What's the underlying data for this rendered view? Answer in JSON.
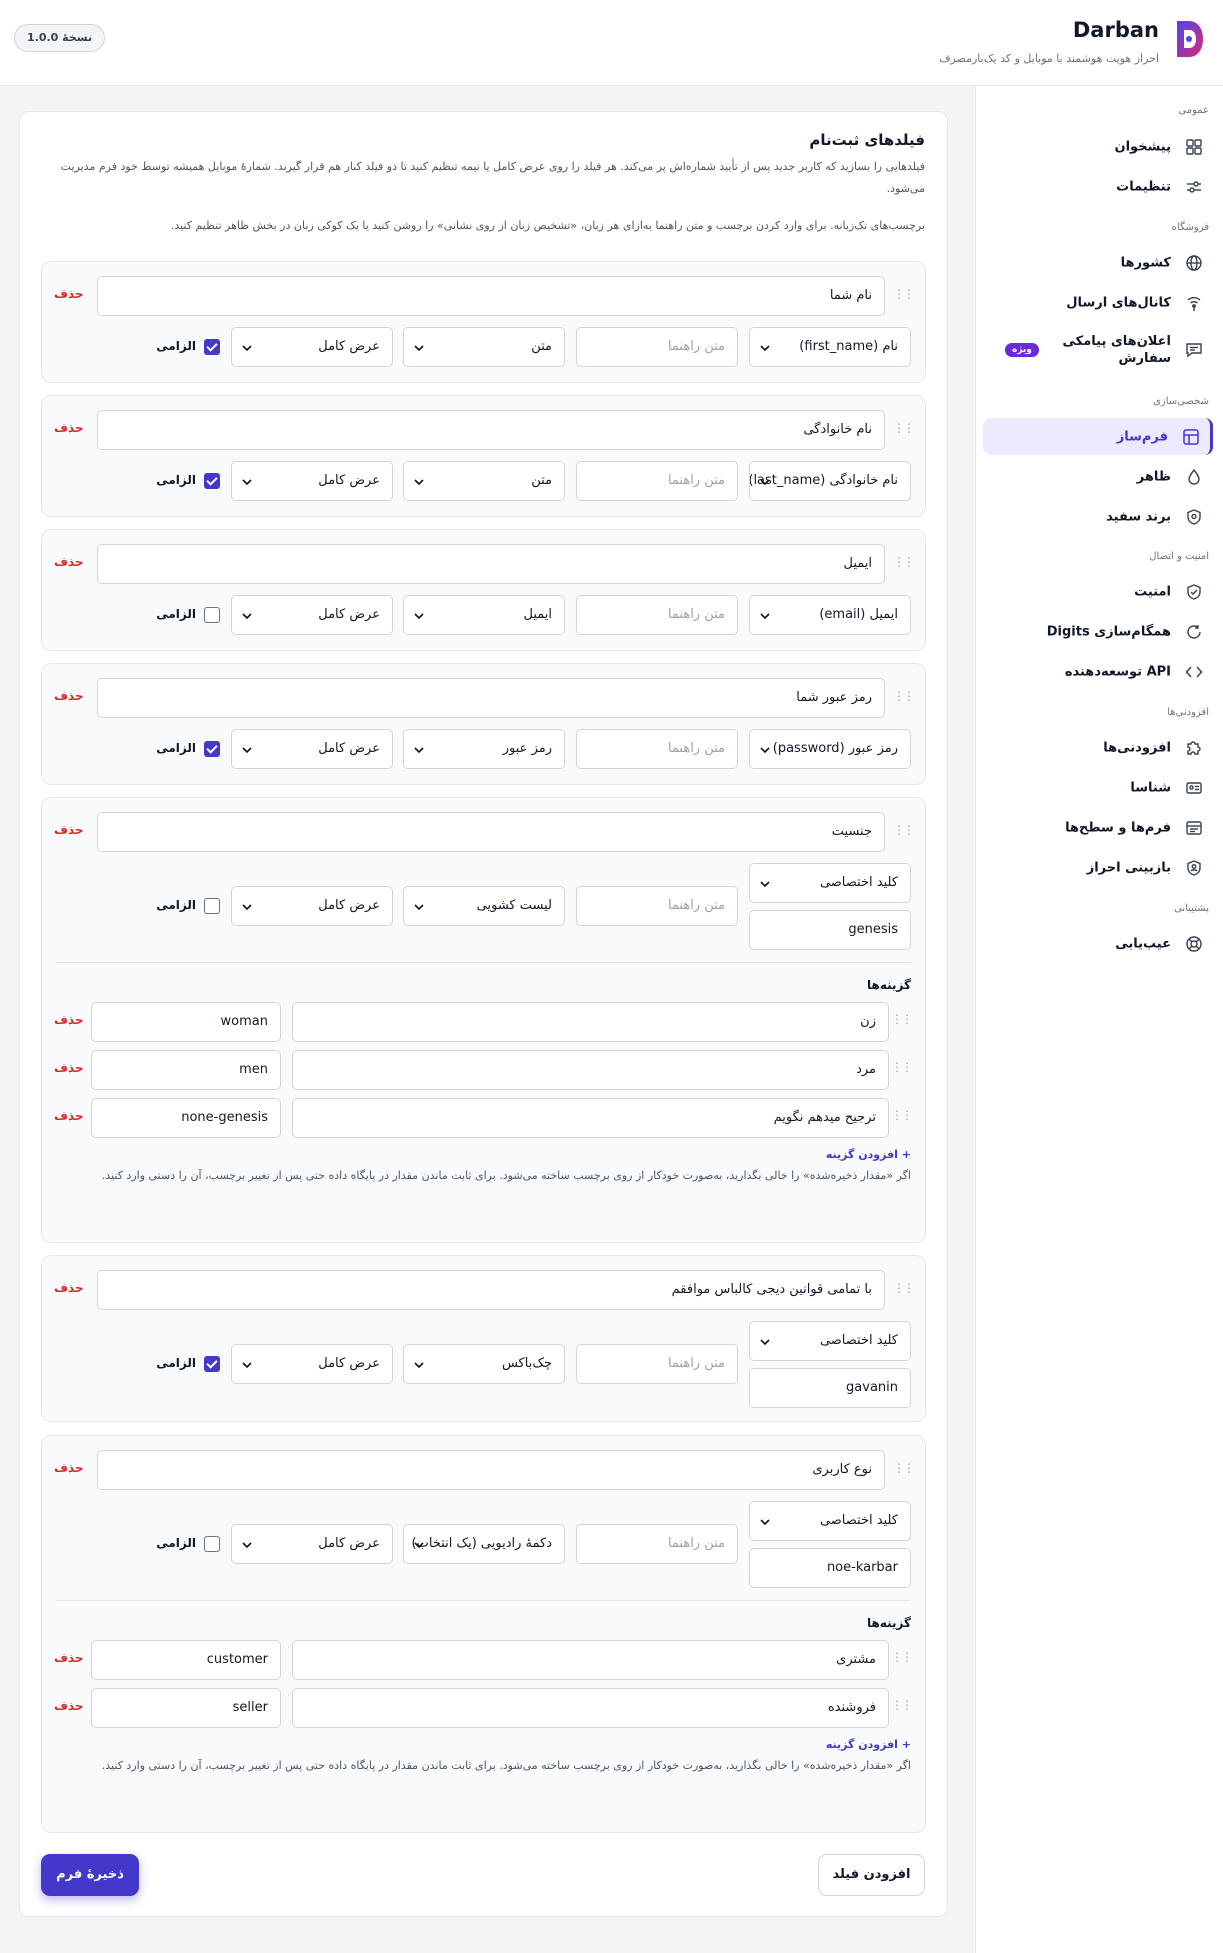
{
  "app": {
    "brand": "Darban",
    "tagline": "احراز هویت هوشمند با موبایل و کد یک‌بارمصرف",
    "version": "نسخهٔ 1.0.0"
  },
  "sidebar": {
    "sections": {
      "general": "عمومی",
      "shop": "فروشگاه",
      "custom": "شخصی‌سازی",
      "security": "امنیت و اتصال",
      "addons": "افزودنی‌ها",
      "support": "پشتیبانی"
    },
    "items": {
      "dashboard": "پیشخوان",
      "settings": "تنظیمات",
      "countries": "کشورها",
      "channels": "کانال‌های ارسال",
      "sms": "اعلان‌های پیامکی سفارش",
      "formbuilder": "فرم‌ساز",
      "appearance": "ظاهر",
      "whitelabel": "برند سفید",
      "security": "امنیت",
      "digits": "همگام‌سازی Digits",
      "api": "API توسعه‌دهنده",
      "addons": "افزودنی‌ها",
      "shenasa": "شناسا",
      "forms": "فرم‌ها و سطح‌ها",
      "reverify": "بازبینی احراز",
      "troubleshoot": "عیب‌یابی"
    },
    "badge": "ویژه"
  },
  "card": {
    "title": "فیلدهای ثبت‌نام",
    "desc": "فیلدهایی را بسازید که کاربر جدید پس از تأیید شماره‌اش پر می‌کند. هر فیلد را روی عرض کامل یا نیمه تنظیم کنید تا دو فیلد کنار هم قرار گیرند. شمارهٔ موبایل همیشه توسط خود فرم مدیریت می‌شود.",
    "note": "برچسب‌های تک‌زبانه. برای وارد کردن برچسب و متن راهنما به‌ازای هر زبان، «تشخیص زبان از روی نشانی» را روشن کنید یا یک کوکی زبان در بخش ظاهر تنظیم کنید."
  },
  "common": {
    "delete": "حذف",
    "required": "الزامی",
    "hint_placeholder": "متن راهنما",
    "width_full": "عرض کامل",
    "custom_key": "کلید اختصاصی",
    "options_title": "گزینه‌ها",
    "add_option": "+ افزودن گزینه",
    "option_hint": "اگر «مقدار ذخیره‌شده» را خالی بگذارید، به‌صورت خودکار از روی برچسب ساخته می‌شود. برای ثابت ماندن مقدار در پایگاه داده حتی پس از تغییر برچسب، آن را دستی وارد کنید."
  },
  "fields": [
    {
      "label": "نام شما",
      "key": "نام (first_name)",
      "type": "متن",
      "required": true
    },
    {
      "label": "نام خانوادگی",
      "key": "نام خانوادگی (last_name)",
      "type": "متن",
      "required": true
    },
    {
      "label": "ایمیل",
      "key": "ایمیل (email)",
      "type": "ایمیل",
      "required": false
    },
    {
      "label": "رمز عبور شما",
      "key": "رمز عبور (password)",
      "type": "رمز عبور",
      "required": true
    },
    {
      "label": "جنسیت",
      "custom_value": "genesis",
      "type": "لیست کشویی",
      "required": false,
      "options": [
        {
          "label": "زن",
          "value": "woman"
        },
        {
          "label": "مرد",
          "value": "men"
        },
        {
          "label": "ترجیح میدهم نگویم",
          "value": "none-genesis"
        }
      ]
    },
    {
      "label": "با تمامی قوانین دیجی کالباس موافقم",
      "custom_value": "gavanin",
      "type": "چک‌باکس",
      "required": true
    },
    {
      "label": "نوع کاربری",
      "custom_value": "noe-karbar",
      "type": "دکمهٔ رادیویی (یک انتخاب)",
      "required": false,
      "options": [
        {
          "label": "مشتری",
          "value": "customer"
        },
        {
          "label": "فروشنده",
          "value": "seller"
        }
      ]
    }
  ],
  "buttons": {
    "save": "ذخیرهٔ فرم",
    "add_field": "افزودن فیلد"
  },
  "colors": {
    "accent": "#4338ca",
    "danger": "#dc2626",
    "badge": "#6d28d9"
  }
}
